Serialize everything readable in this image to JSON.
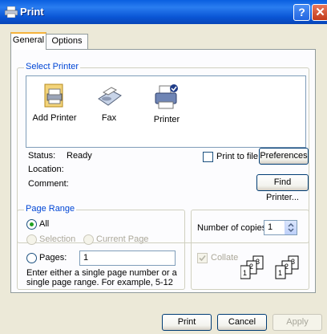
{
  "window": {
    "title": "Print",
    "help_glyph": "?",
    "close_glyph": "✕"
  },
  "tabs": [
    {
      "label": "General"
    },
    {
      "label": "Options"
    }
  ],
  "select_printer": {
    "legend": "Select Printer",
    "printers": [
      {
        "label": "Add Printer",
        "icon": "add-printer-icon"
      },
      {
        "label": "Fax",
        "icon": "fax-icon"
      },
      {
        "label": "Printer",
        "icon": "printer-icon"
      }
    ],
    "status_label": "Status:",
    "status_value": "Ready",
    "location_label": "Location:",
    "comment_label": "Comment:",
    "print_to_file_label": "Print to file",
    "preferences_label": "Preferences",
    "find_printer_label": "Find Printer..."
  },
  "page_range": {
    "legend": "Page Range",
    "all_label": "All",
    "selection_label": "Selection",
    "current_page_label": "Current Page",
    "pages_label": "Pages:",
    "pages_value": "1",
    "hint": "Enter either a single page number or a single page range.  For example, 5-12"
  },
  "copies": {
    "number_label": "Number of copies:",
    "number_value": "1",
    "collate_label": "Collate"
  },
  "footer": {
    "print_label": "Print",
    "cancel_label": "Cancel",
    "apply_label": "Apply"
  }
}
